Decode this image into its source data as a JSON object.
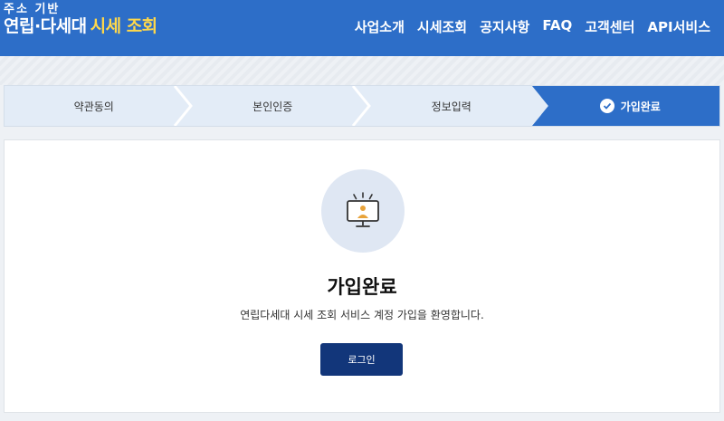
{
  "header": {
    "logo_sub": "주소 기반",
    "logo_main": "연립·다세대",
    "logo_accent": "시세 조회",
    "nav": [
      "사업소개",
      "시세조회",
      "공지사항",
      "FAQ",
      "고객센터",
      "API서비스"
    ]
  },
  "steps": [
    {
      "label": "약관동의",
      "active": false
    },
    {
      "label": "본인인증",
      "active": false
    },
    {
      "label": "정보입력",
      "active": false
    },
    {
      "label": "가입완료",
      "active": true
    }
  ],
  "content": {
    "icon": "monitor-user-icon",
    "title": "가입완료",
    "description": "연립다세대 시세 조회 서비스 계정 가입을 환영합니다.",
    "login_label": "로그인"
  },
  "colors": {
    "header_bg": "#2d6ec8",
    "accent": "#ffd84a",
    "button_bg": "#12367a",
    "step_bg": "#e3ecf7"
  }
}
